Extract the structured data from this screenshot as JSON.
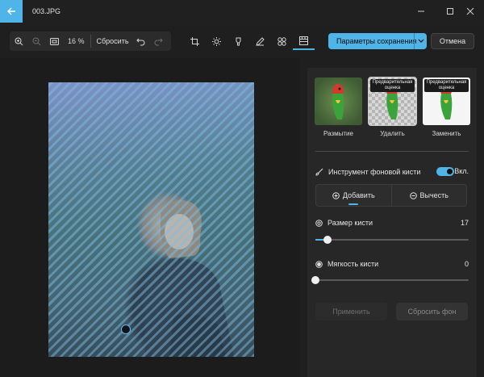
{
  "window": {
    "filename": "003.JPG"
  },
  "toolbar": {
    "zoom": "16 %",
    "reset_label": "Сбросить"
  },
  "actions": {
    "save_label": "Параметры сохранения",
    "cancel_label": "Отмена"
  },
  "panel": {
    "thumbs": [
      {
        "label": "Размытие",
        "badge": ""
      },
      {
        "label": "Удалить",
        "badge": "Предварительная оценка"
      },
      {
        "label": "Заменить",
        "badge": "Предварительная оценка"
      }
    ],
    "brush_tool": {
      "label": "Инструмент фоновой кисти",
      "toggle_label": "Вкл.",
      "on": true
    },
    "modes": {
      "add": "Добавить",
      "subtract": "Вычесть"
    },
    "brush_size": {
      "label": "Размер кисти",
      "value": "17"
    },
    "brush_softness": {
      "label": "Мягкость кисти",
      "value": "0"
    },
    "apply_label": "Применить",
    "reset_bg_label": "Сбросить фон"
  },
  "colors": {
    "accent": "#4fb4e8",
    "background": "#1f1f1f",
    "panel": "#272727"
  }
}
